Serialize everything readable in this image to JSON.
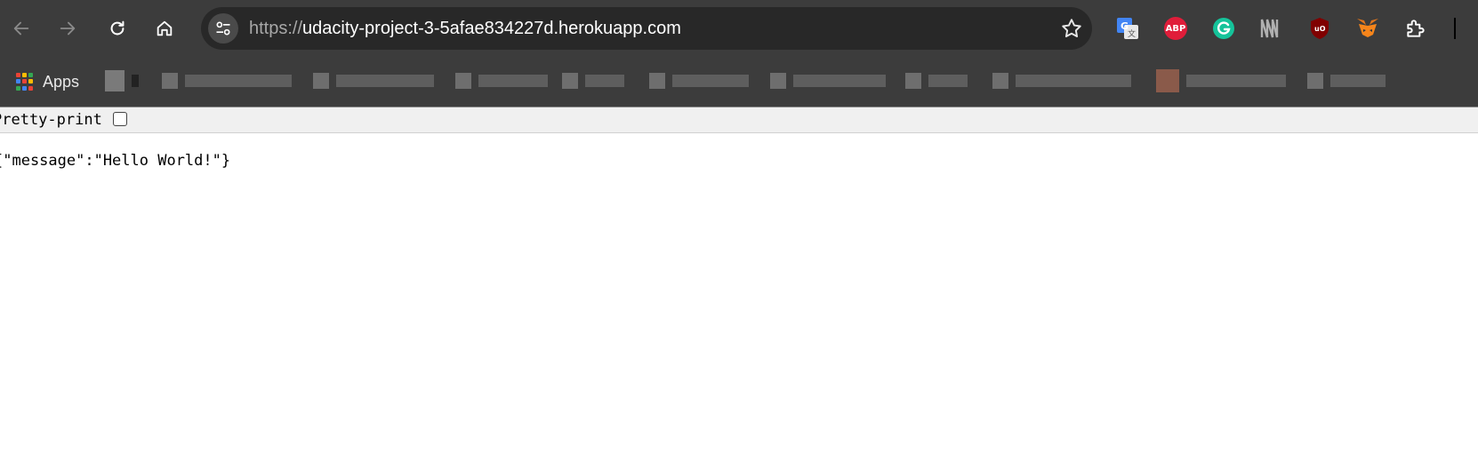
{
  "browser": {
    "url_scheme": "https://",
    "url_host": "udacity-project-3-5afae834227d.herokuapp.com",
    "nav_icons": [
      "back-arrow-icon",
      "forward-arrow-icon",
      "reload-icon",
      "home-icon"
    ],
    "extensions": [
      "google-translate-icon",
      "adblock-plus-icon",
      "grammarly-icon",
      "readwise-icon",
      "ublock-origin-icon",
      "metamask-icon",
      "extensions-puzzle-icon"
    ],
    "abp_text": "ABP"
  },
  "bookmarks_bar": {
    "apps_label": "Apps"
  },
  "viewer": {
    "pretty_print_label": "Pretty-print",
    "pretty_print_checked": false,
    "json_text": "{\"message\":\"Hello World!\"}"
  },
  "colors": {
    "toolbar_bg": "#3c3c3c",
    "omnibox_bg": "#282828",
    "page_bg": "#ffffff"
  }
}
